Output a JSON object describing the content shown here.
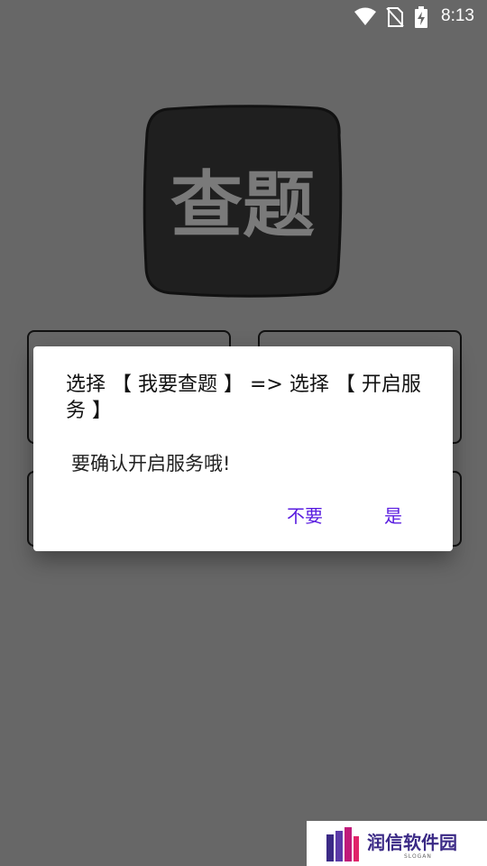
{
  "status_bar": {
    "time": "8:13",
    "icons": [
      "wifi-icon",
      "no-sim-icon",
      "battery-charging-icon"
    ]
  },
  "app": {
    "logo_text": "查题"
  },
  "dialog": {
    "title": "选择 【 我要查题 】 => 选择 【 开启服务 】",
    "message": "要确认开启服务哦!",
    "negative_label": "不要",
    "positive_label": "是",
    "accent_color": "#5a1de0"
  },
  "watermark": {
    "text": "润信软件园",
    "subtext": "SLOGAN"
  }
}
